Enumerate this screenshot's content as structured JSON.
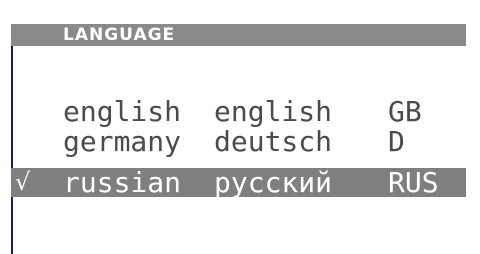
{
  "header": {
    "title": "LANGUAGE"
  },
  "languages": [
    {
      "name": "english",
      "native": "english",
      "code": "GB",
      "selected": false,
      "check": ""
    },
    {
      "name": "germany",
      "native": "deutsch",
      "code": "D",
      "selected": false,
      "check": ""
    },
    {
      "name": "russian",
      "native": "русский",
      "code": "RUS",
      "selected": true,
      "check": "√"
    }
  ],
  "colors": {
    "header_bg": "#8a8a8a",
    "selected_bg": "#7f7f7f",
    "text": "#4b4b4b",
    "border": "#1a1a6e"
  }
}
